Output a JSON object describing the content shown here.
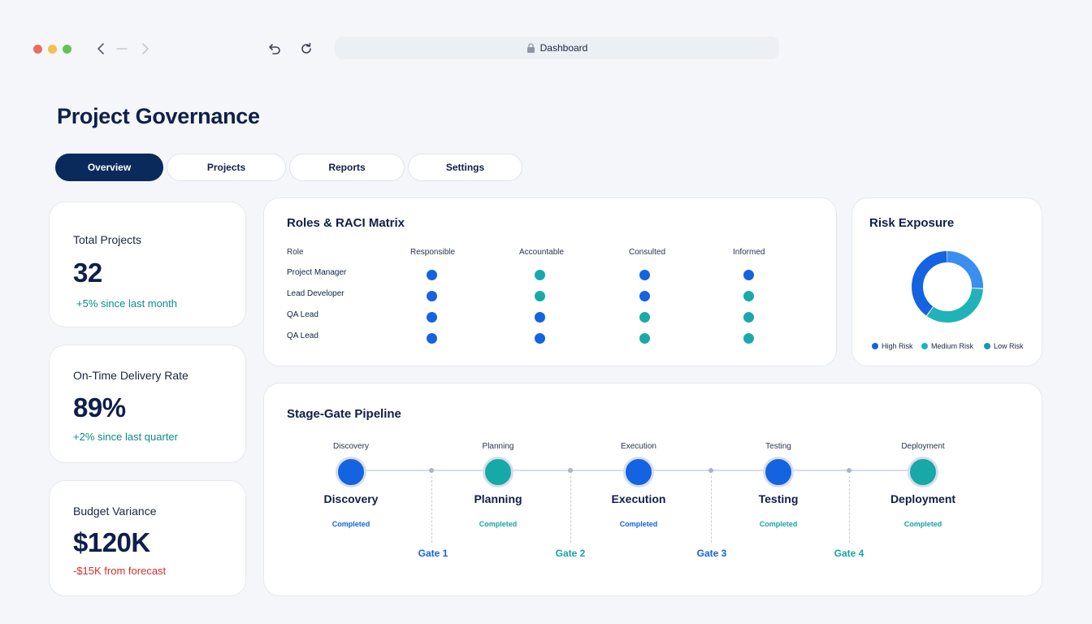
{
  "browser": {
    "url_label": "Dashboard"
  },
  "page": {
    "title": "Project Governance"
  },
  "tabs": [
    {
      "label": "Overview",
      "active": true
    },
    {
      "label": "Projects",
      "active": false
    },
    {
      "label": "Reports",
      "active": false
    },
    {
      "label": "Settings",
      "active": false
    }
  ],
  "kpis": [
    {
      "label": "Total Projects",
      "value": "32",
      "delta": "+5% since last month",
      "delta_color": "#0f8a8a"
    },
    {
      "label": "On-Time Delivery Rate",
      "value": "89%",
      "delta": "+2% since last quarter",
      "delta_color": "#0f8a8a"
    },
    {
      "label": "Budget Variance",
      "value": "$120K",
      "delta": "-$15K from forecast",
      "delta_color": "#d62f2f"
    }
  ],
  "raci": {
    "title": "Roles & RACI Matrix",
    "columns": [
      "Role",
      "Responsible",
      "Accountable",
      "Consulted",
      "Informed"
    ],
    "rows": [
      {
        "role": "Project Manager",
        "cells": [
          "blue",
          "teal",
          "blue",
          "blue"
        ]
      },
      {
        "role": "Lead Developer",
        "cells": [
          "blue",
          "teal",
          "blue",
          "teal"
        ]
      },
      {
        "role": "QA Lead",
        "cells": [
          "blue",
          "blue",
          "teal",
          "teal"
        ]
      },
      {
        "role": "QA Lead",
        "cells": [
          "blue",
          "blue",
          "teal",
          "teal"
        ]
      }
    ]
  },
  "risk": {
    "title": "Risk Exposure",
    "legend": [
      {
        "label": "High Risk",
        "color": "#1463e0"
      },
      {
        "label": "Medium Risk",
        "color": "#1fb3b8"
      },
      {
        "label": "Low Risk",
        "color": "#149aa8"
      }
    ],
    "segments": [
      {
        "color": "#3a8ef0",
        "fraction": 0.26
      },
      {
        "color": "#1fb3b8",
        "fraction": 0.34
      },
      {
        "color": "#1463e0",
        "fraction": 0.4
      }
    ]
  },
  "pipeline": {
    "title": "Stage-Gate Pipeline",
    "stages": [
      {
        "top_label": "Discovery",
        "name": "Discovery",
        "status": "Completed",
        "color": "#1463e0",
        "status_color": "#1463e0"
      },
      {
        "top_label": "Planning",
        "name": "Planning",
        "status": "Completed",
        "color": "#17a8a8",
        "status_color": "#17a3a3"
      },
      {
        "top_label": "Execution",
        "name": "Execution",
        "status": "Completed",
        "color": "#1463e0",
        "status_color": "#1463e0"
      },
      {
        "top_label": "Testing",
        "name": "Testing",
        "status": "Completed",
        "color": "#1463e0",
        "status_color": "#17a3a3"
      },
      {
        "top_label": "Deployment",
        "name": "Deployment",
        "status": "Completed",
        "color": "#17a8a8",
        "status_color": "#17a3a3"
      }
    ],
    "gates": [
      {
        "label": "Gate 1",
        "color": "#1463e0"
      },
      {
        "label": "Gate 2",
        "color": "#17a3a3"
      },
      {
        "label": "Gate 3",
        "color": "#1463e0"
      },
      {
        "label": "Gate 4",
        "color": "#17a3a3"
      }
    ]
  },
  "colors": {
    "blue": "#1463e0",
    "teal": "#1aa9ab",
    "navy": "#0b2a5c"
  }
}
